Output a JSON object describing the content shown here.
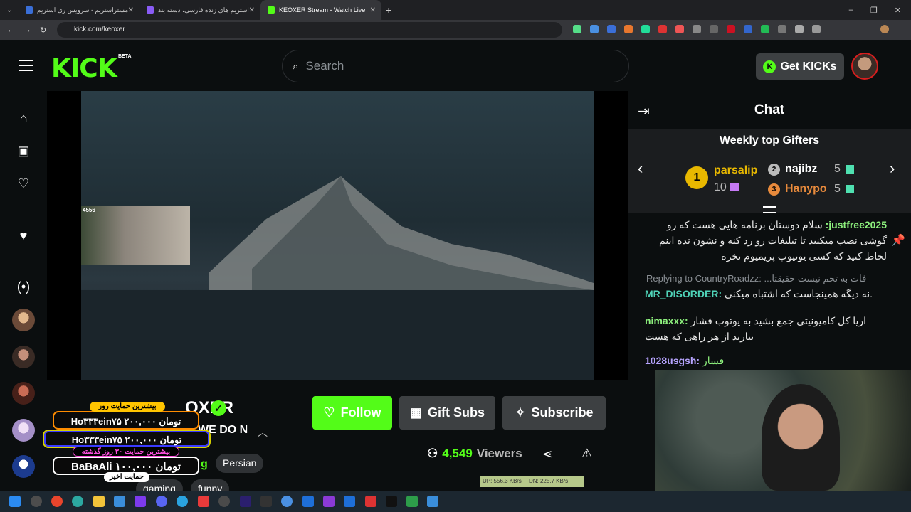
{
  "browser": {
    "tabs": [
      {
        "title": "مستراستریم - سرویس ری استریم",
        "active": false,
        "color": "#3a6fd8"
      },
      {
        "title": "استریم های زنده فارسی، دسته بند",
        "active": false,
        "color": "#8a5cf6"
      },
      {
        "title": "KEOXER Stream - Watch Live",
        "active": true,
        "color": "#53fc18"
      }
    ],
    "url": "kick.com/keoxer"
  },
  "header": {
    "logo": "KICK",
    "beta": "BETA",
    "search_placeholder": "Search",
    "get_kicks": "Get KICKs",
    "kicks_icon": "K"
  },
  "player": {
    "cam_viewers": "4556"
  },
  "channel": {
    "name_partial": "OXER",
    "title_partial": "WE DO N",
    "follow": "Follow",
    "gift_subs": "Gift Subs",
    "subscribe": "Subscribe",
    "viewers_count": "4,549",
    "viewers_label": "Viewers",
    "tags": [
      "Persian",
      "gaming",
      "funny"
    ],
    "category_partial": "g"
  },
  "donations": [
    {
      "label": "بیشترین حمایت روز",
      "amount": "Ho۳۳۳ein۷۵   ۲۰۰,۰۰۰ تومان"
    },
    {
      "label": "بیشترین حمایت ۳۰ روز گذشته",
      "amount": "Ho۳۳۳ein۷۵   ۲۰۰,۰۰۰ تومان"
    },
    {
      "label": "حمایت اخیر",
      "amount": "BaBaAli   ۱۰۰,۰۰۰ تومان"
    }
  ],
  "chat": {
    "title": "Chat",
    "weekly_title": "Weekly top Gifters",
    "gifters": [
      {
        "rank": "1",
        "name": "parsalip",
        "count": "10"
      },
      {
        "rank": "2",
        "name": "najibz",
        "count": "5"
      },
      {
        "rank": "3",
        "name": "Hanypo",
        "count": "5"
      }
    ],
    "messages": [
      {
        "user": "justfree2025:",
        "text": "سلام دوستان برنامه هایی هست که رو گوشی نصب میکنید تا تبلیغات رو رد کنه و نشون نده اینم لحاظ کنید که کسی یوتیوب پریمیوم نخره",
        "color": "#8ef27e"
      },
      {
        "reply": "Replying to CountryRoadzz: ...فات به تخم نیست حقیقتا"
      },
      {
        "user": "MR_DISORDER:",
        "text": "نه دیگه همینجاست که اشتباه میکنی.",
        "color": "#4fd3b8"
      },
      {
        "user": "nimaxxx:",
        "text": "اریا کل کامیونیتی جمع بشید به یوتوب فشار بیارید از هر راهی که هست",
        "color": "#8ef27e"
      },
      {
        "user": "1028usgsh:",
        "text": "فسار",
        "color": "#b7a4ff"
      }
    ]
  },
  "system": {
    "net_up": "UP: 556.3 KB/s",
    "net_down": "DN: 225.7 KB/s"
  }
}
